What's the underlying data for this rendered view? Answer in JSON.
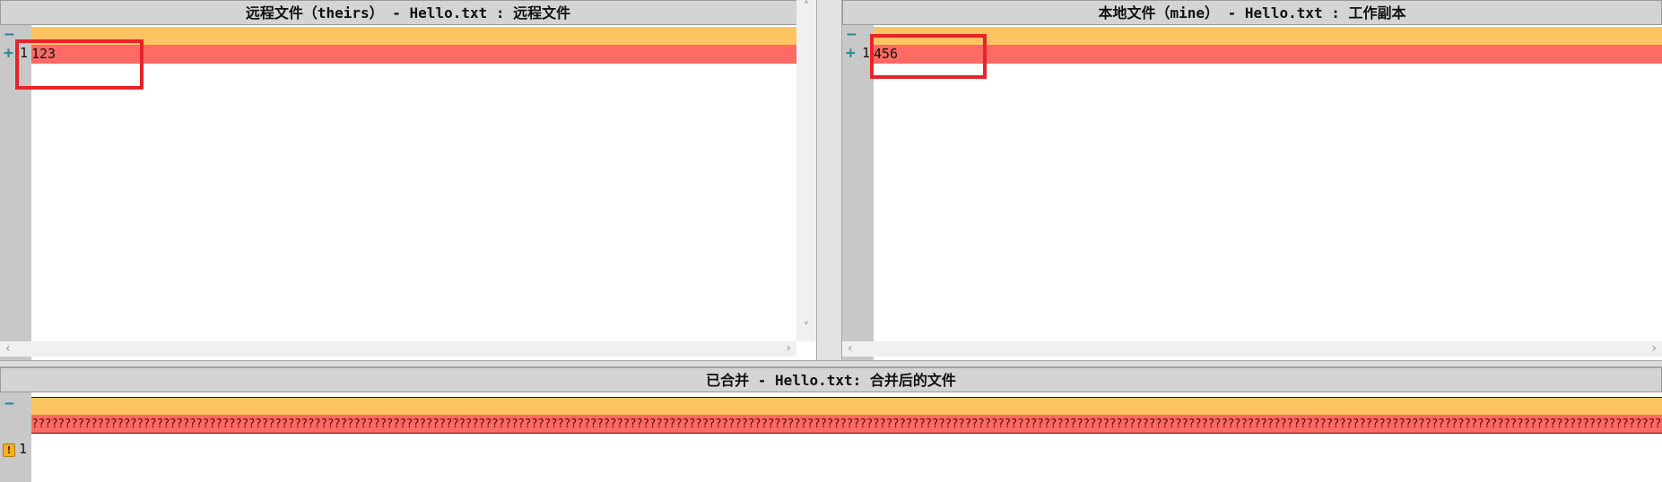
{
  "left_pane": {
    "title": "远程文件（theirs） - Hello.txt : 远程文件",
    "gutter_minus": "−",
    "gutter_plus": "+",
    "line_number": "1",
    "line_text": "123"
  },
  "right_pane": {
    "title": "本地文件（mine） - Hello.txt : 工作副本",
    "gutter_minus": "−",
    "gutter_plus": "+",
    "line_number": "1",
    "line_text": "456"
  },
  "merged_pane": {
    "title": "已合并 - Hello.txt: 合并后的文件",
    "gutter_minus": "−",
    "warning_icon_glyph": "!",
    "line_number": "1",
    "line_text": "??????????????????????????????????????????????????????????????????????????????????????????????????????????????????????????????????????????????????????????????????????????????????????????????????????????????????????????????????????????????????????????????????????????"
  },
  "scroll_arrows": {
    "left": "‹",
    "right": "›",
    "up": "˄",
    "down": "˅"
  },
  "colors": {
    "conflict_orange": "#fdc463",
    "conflict_red": "#ff6a64",
    "highlight_box": "#e8232b",
    "gutter_gray": "#c8c8c8"
  }
}
